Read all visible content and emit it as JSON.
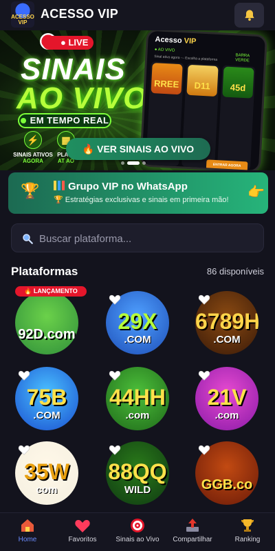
{
  "header": {
    "title": "ACESSO VIP",
    "logo_text": "ACESSO VIP"
  },
  "banner": {
    "live_badge": "LIVE",
    "headline_line1": "SINAIS",
    "headline_line2": "AO VIVO",
    "realtime_label": "EM TEMPO REAL",
    "features": [
      {
        "line1": "SINAIS ATIVOS",
        "line2": "AGORA"
      },
      {
        "line1": "PLATA",
        "line2": "AT AO"
      }
    ],
    "phone": {
      "title_a": "Acesso ",
      "title_b": "VIP",
      "live": "● AO VIVO",
      "sub": "Sinal ativo agora — Escolha a plataforma",
      "side_label": "BARRA VERDE",
      "cards": [
        "RREE",
        "D11",
        "45d"
      ],
      "enter_label": "ENTRAR AGORA"
    },
    "cta_label": "🔥 VER SINAIS AO VIVO",
    "carousel": {
      "count": 3,
      "active": 2
    }
  },
  "vip_group": {
    "title": "Grupo VIP no WhatsApp",
    "subtitle": "🏆 Estratégias exclusivas e sinais em primeira mão!"
  },
  "search": {
    "placeholder": "Buscar plataforma..."
  },
  "platforms": {
    "title": "Plataformas",
    "count_label": "86 disponíveis",
    "launch_badge": "🔥 LANÇAMENTO",
    "items": [
      {
        "name": "92D.com",
        "colors": [
          "#2f8f3a",
          "#6bd14a"
        ],
        "text_color": "#ffffff"
      },
      {
        "name": "29X",
        "sub": ".COM",
        "colors": [
          "#1e4fb8",
          "#4fa0ff"
        ],
        "text_color": "#b6ff3a"
      },
      {
        "name": "6789H",
        "sub": ".COM",
        "colors": [
          "#3a1a08",
          "#8a4a12"
        ],
        "text_color": "#ffd54a"
      },
      {
        "name": "75B",
        "sub": ".COM",
        "colors": [
          "#1a4fd0",
          "#4ac0ff"
        ],
        "text_color": "#ffe14a"
      },
      {
        "name": "44HH",
        "sub": ".com",
        "colors": [
          "#1f6a1a",
          "#4cbf3a"
        ],
        "text_color": "#ffe14a"
      },
      {
        "name": "21V",
        "sub": ".com",
        "colors": [
          "#8a1aa8",
          "#e64ad0"
        ],
        "text_color": "#ffe14a"
      },
      {
        "name": "35W",
        "sub": "com",
        "colors": [
          "#f4efe0",
          "#fff8e8"
        ],
        "text_color": "#e8a010"
      },
      {
        "name": "88QQ",
        "sub": "WILD",
        "colors": [
          "#0f3a12",
          "#2a7a1a"
        ],
        "text_color": "#ffe14a"
      },
      {
        "name": "GGB.co",
        "colors": [
          "#6a1a08",
          "#c24a12"
        ],
        "text_color": "#ffe14a"
      }
    ]
  },
  "bottom_nav": [
    {
      "label": "Home",
      "icon": "home-icon",
      "active": true
    },
    {
      "label": "Favoritos",
      "icon": "heart-icon",
      "active": false
    },
    {
      "label": "Sinais ao Vivo",
      "icon": "target-icon",
      "active": false
    },
    {
      "label": "Compartilhar",
      "icon": "share-icon",
      "active": false
    },
    {
      "label": "Ranking",
      "icon": "trophy-icon",
      "active": false
    }
  ]
}
